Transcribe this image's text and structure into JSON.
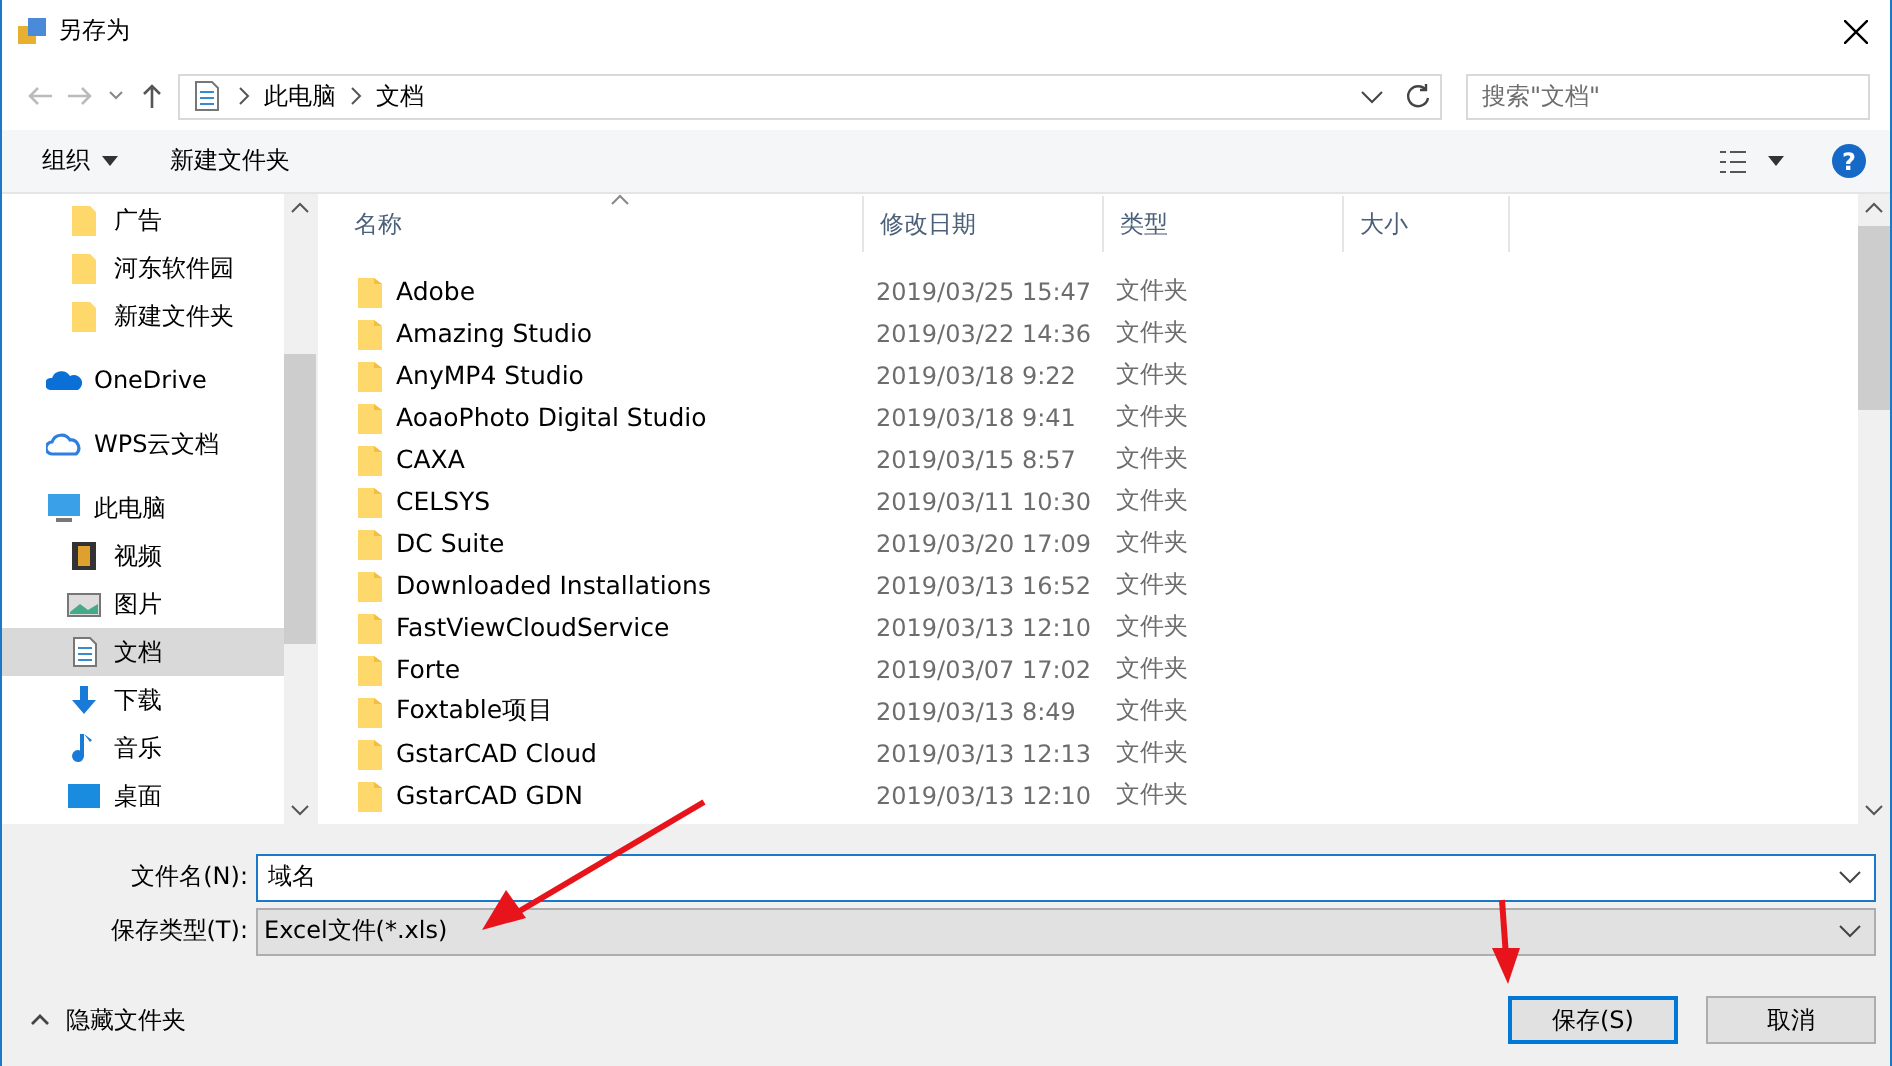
{
  "window": {
    "title": "另存为"
  },
  "address": {
    "path": [
      "此电脑",
      "文档"
    ]
  },
  "search": {
    "placeholder": "搜索\"文档\""
  },
  "toolbar": {
    "organize": "组织",
    "new_folder": "新建文件夹",
    "help": "?"
  },
  "sidebar": {
    "items": [
      {
        "label": "广告",
        "kind": "folder",
        "selected": false
      },
      {
        "label": "河东软件园",
        "kind": "folder",
        "selected": false
      },
      {
        "label": "新建文件夹",
        "kind": "folder",
        "selected": false
      },
      {
        "label": "OneDrive",
        "kind": "cloud",
        "selected": false
      },
      {
        "label": "WPS云文档",
        "kind": "cloud-outline",
        "selected": false
      },
      {
        "label": "此电脑",
        "kind": "computer",
        "selected": false,
        "children": [
          {
            "label": "视频",
            "kind": "video",
            "selected": false
          },
          {
            "label": "图片",
            "kind": "picture",
            "selected": false
          },
          {
            "label": "文档",
            "kind": "document",
            "selected": true
          },
          {
            "label": "下载",
            "kind": "download",
            "selected": false
          },
          {
            "label": "音乐",
            "kind": "music",
            "selected": false
          },
          {
            "label": "桌面",
            "kind": "desktop",
            "selected": false
          }
        ]
      }
    ]
  },
  "table": {
    "columns": [
      "名称",
      "修改日期",
      "类型",
      "大小"
    ],
    "rows": [
      {
        "name": "Adobe",
        "date": "2019/03/25 15:47",
        "type": "文件夹"
      },
      {
        "name": "Amazing Studio",
        "date": "2019/03/22 14:36",
        "type": "文件夹"
      },
      {
        "name": "AnyMP4 Studio",
        "date": "2019/03/18 9:22",
        "type": "文件夹"
      },
      {
        "name": "AoaoPhoto Digital Studio",
        "date": "2019/03/18 9:41",
        "type": "文件夹"
      },
      {
        "name": "CAXA",
        "date": "2019/03/15 8:57",
        "type": "文件夹"
      },
      {
        "name": "CELSYS",
        "date": "2019/03/11 10:30",
        "type": "文件夹"
      },
      {
        "name": "DC Suite",
        "date": "2019/03/20 17:09",
        "type": "文件夹"
      },
      {
        "name": "Downloaded Installations",
        "date": "2019/03/13 16:52",
        "type": "文件夹"
      },
      {
        "name": "FastViewCloudService",
        "date": "2019/03/13 12:10",
        "type": "文件夹"
      },
      {
        "name": "Forte",
        "date": "2019/03/07 17:02",
        "type": "文件夹"
      },
      {
        "name": "Foxtable项目",
        "date": "2019/03/13 8:49",
        "type": "文件夹"
      },
      {
        "name": "GstarCAD Cloud",
        "date": "2019/03/13 12:13",
        "type": "文件夹"
      },
      {
        "name": "GstarCAD GDN",
        "date": "2019/03/13 12:10",
        "type": "文件夹"
      }
    ]
  },
  "form": {
    "filename_label": "文件名(N):",
    "filename": "域名",
    "type_label": "保存类型(T):",
    "type": "Excel文件(*.xls)"
  },
  "footer": {
    "hide_folders": "隐藏文件夹",
    "save": "保存(S)",
    "cancel": "取消"
  }
}
